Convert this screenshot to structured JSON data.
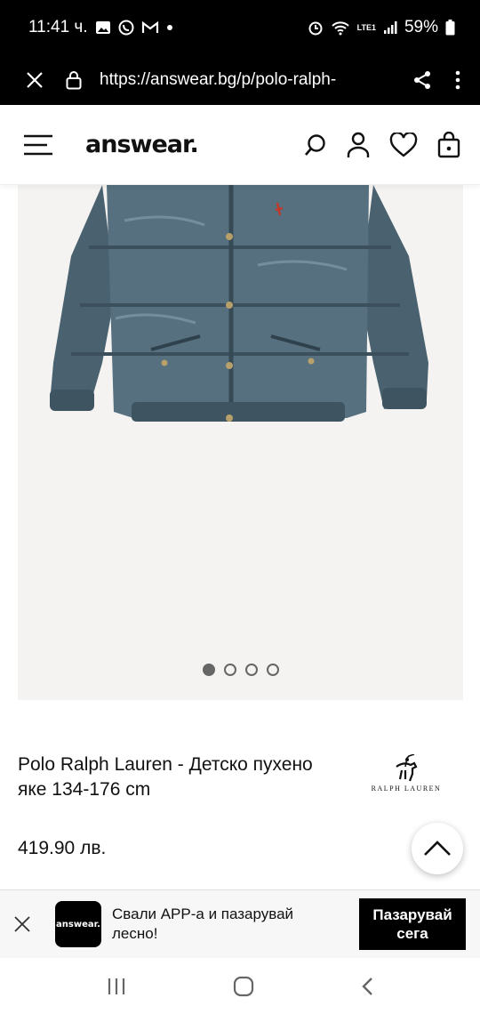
{
  "status_bar": {
    "time": "11:41 ч.",
    "battery": "59%",
    "network": "LTE1"
  },
  "browser": {
    "url": "https://answear.bg/p/polo-ralph-"
  },
  "header": {
    "logo": "answear."
  },
  "gallery": {
    "image_count": 4,
    "active_index": 0
  },
  "product": {
    "title": "Polo Ralph Lauren - Детско пухено яке 134-176 cm",
    "brand": "RALPH LAUREN",
    "price": "419.90 лв."
  },
  "app_banner": {
    "logo": "answear.",
    "text": "Свали APP-а и пазарувай лесно!",
    "button": "Пазарувай сега"
  },
  "colors": {
    "jacket": "#4a6170",
    "gallery_bg": "#f4f3f1"
  }
}
